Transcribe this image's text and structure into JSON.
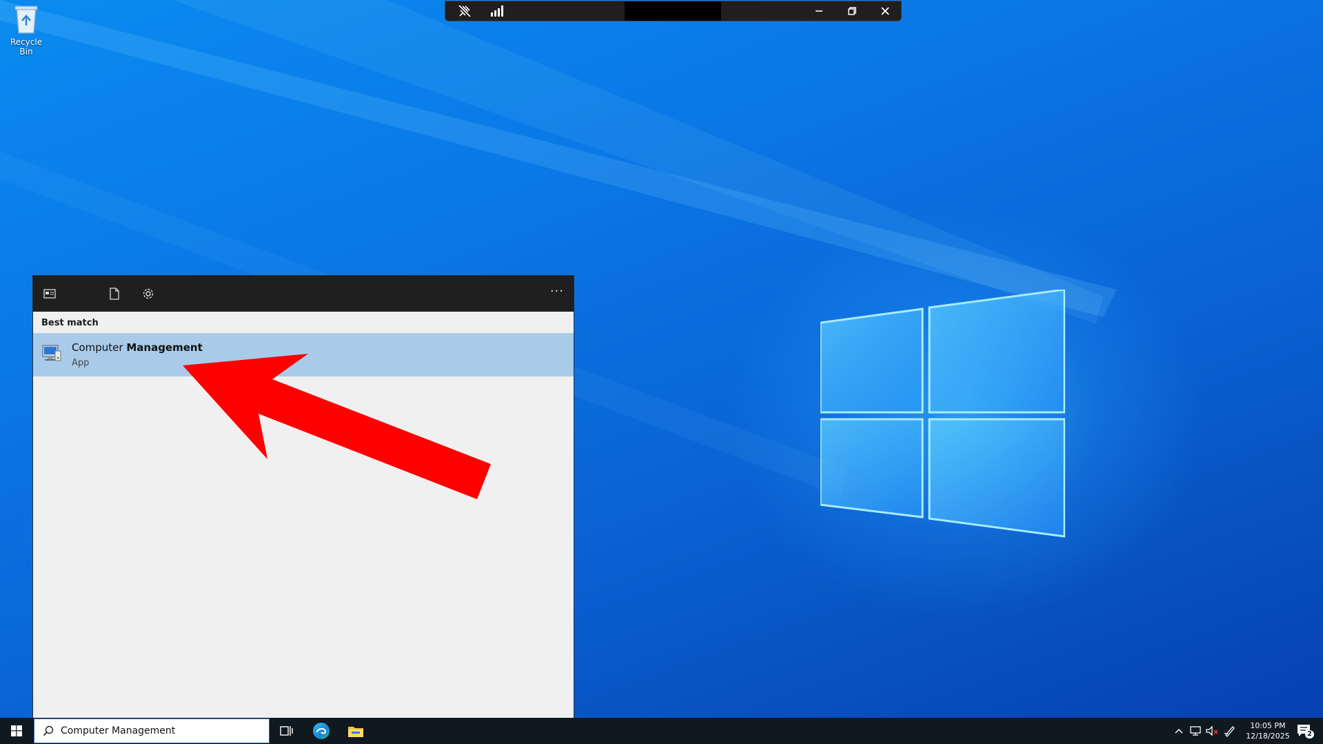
{
  "desktop": {
    "recycle_bin_label": "Recycle Bin"
  },
  "search_panel": {
    "section_label": "Best match",
    "result": {
      "title_regular": "Computer ",
      "title_bold": "Management",
      "subtitle": "App"
    },
    "more_label": "···"
  },
  "taskbar": {
    "search_value": "Computer Management",
    "clock_time": "10:05 PM",
    "clock_date": "12/18/2025",
    "notification_count": "2"
  },
  "colors": {
    "result_highlight": "#a9cbea",
    "panel_bg": "#f0f0f0",
    "panel_header": "#1f1f1f",
    "annotation_arrow": "#ff0000",
    "taskbar": "#101820"
  }
}
